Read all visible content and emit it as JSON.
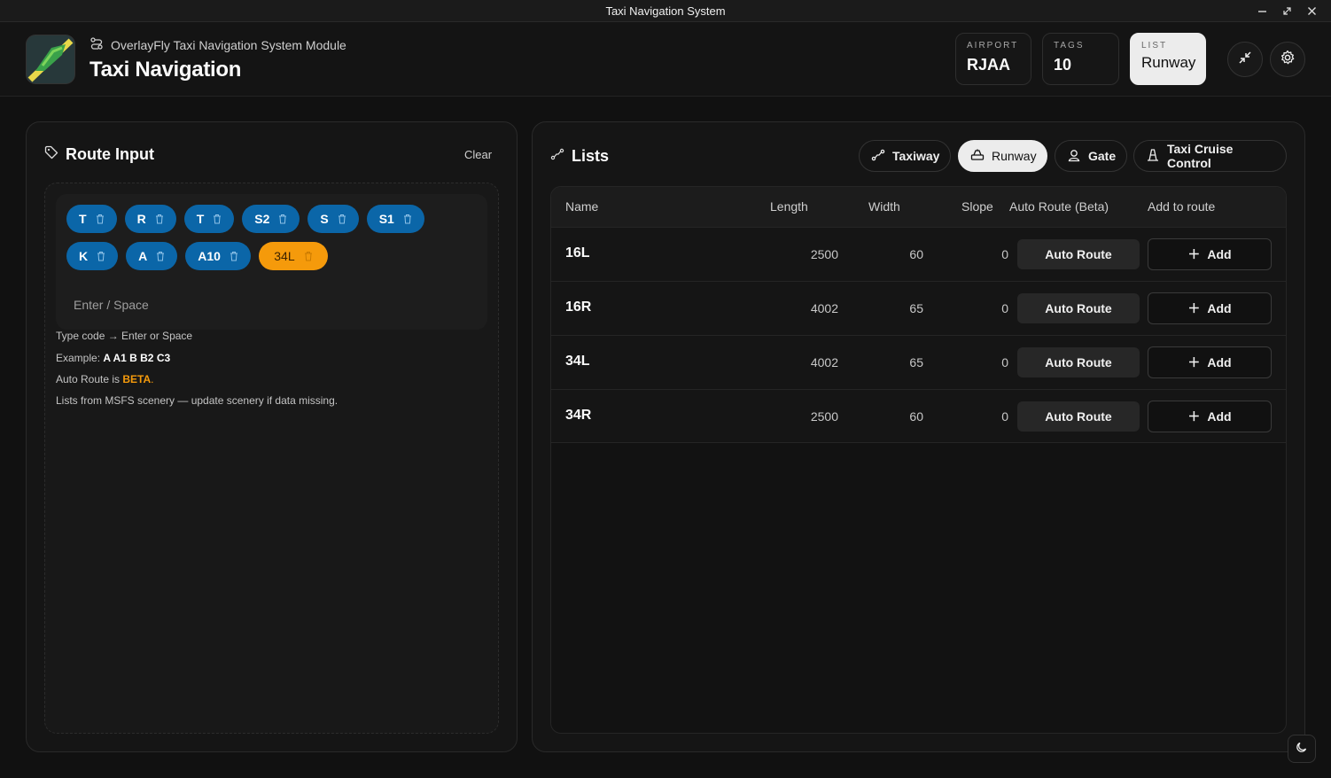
{
  "window": {
    "title": "Taxi Navigation System"
  },
  "header": {
    "subtitle": "OverlayFly Taxi Navigation System Module",
    "title": "Taxi Navigation",
    "stats": [
      {
        "label": "AIRPORT",
        "value": "RJAA"
      },
      {
        "label": "TAGS",
        "value": "10"
      },
      {
        "label": "LIST",
        "value": "Runway"
      }
    ]
  },
  "route_input": {
    "title": "Route Input",
    "clear_label": "Clear",
    "tags": [
      "T",
      "R",
      "T",
      "S2",
      "S",
      "S1",
      "K",
      "A",
      "A10",
      "34L"
    ],
    "highlighted_tag": "34L",
    "input_placeholder": "Enter / Space",
    "help": {
      "line1": "Type code → Enter or Space",
      "line2_prefix": "Example: ",
      "line2_example": "A A1 B B2 C3",
      "line3_prefix": "Auto Route is ",
      "line3_beta": "BETA",
      "line3_suffix": ".",
      "line4": "Lists from MSFS scenery — update scenery if data missing."
    }
  },
  "lists": {
    "title": "Lists",
    "tabs": [
      {
        "label": "Taxiway",
        "icon": "taxiway-icon"
      },
      {
        "label": "Runway",
        "icon": "runway-icon",
        "active": true
      },
      {
        "label": "Gate",
        "icon": "gate-icon"
      },
      {
        "label": "Taxi Cruise Control",
        "icon": "cone-icon"
      }
    ],
    "columns": [
      "Name",
      "Length",
      "Width",
      "Slope",
      "Auto Route (Beta)",
      "Add to route"
    ],
    "rows": [
      {
        "name": "16L",
        "length": "2500",
        "width": "60",
        "slope": "0"
      },
      {
        "name": "16R",
        "length": "4002",
        "width": "65",
        "slope": "0"
      },
      {
        "name": "34L",
        "length": "4002",
        "width": "65",
        "slope": "0"
      },
      {
        "name": "34R",
        "length": "2500",
        "width": "60",
        "slope": "0"
      }
    ],
    "auto_route_label": "Auto Route",
    "add_label": "Add"
  },
  "colors": {
    "tag_blue": "#0b66a8",
    "tag_highlight": "#f59a0b",
    "background": "#111111"
  }
}
